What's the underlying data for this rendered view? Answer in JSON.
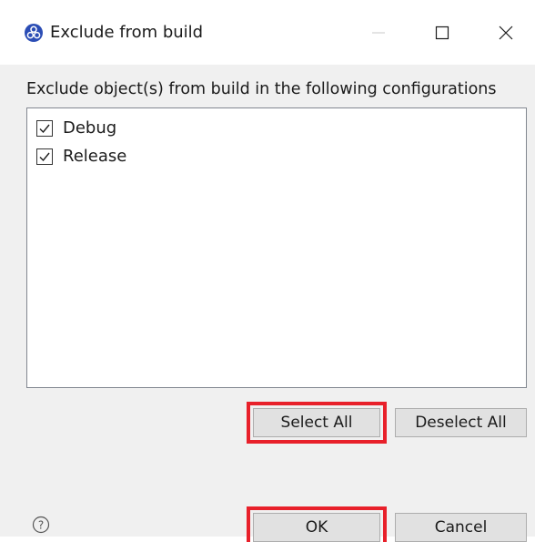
{
  "window": {
    "title": "Exclude from build",
    "icon": "app-logo-icon"
  },
  "description": "Exclude object(s) from build in the following configurations",
  "configurations": [
    {
      "label": "Debug",
      "checked": true
    },
    {
      "label": "Release",
      "checked": true
    }
  ],
  "buttons": {
    "select_all": "Select All",
    "deselect_all": "Deselect All",
    "ok": "OK",
    "cancel": "Cancel"
  },
  "colors": {
    "highlight": "#e8202a",
    "icon_blue": "#2b4db5"
  }
}
